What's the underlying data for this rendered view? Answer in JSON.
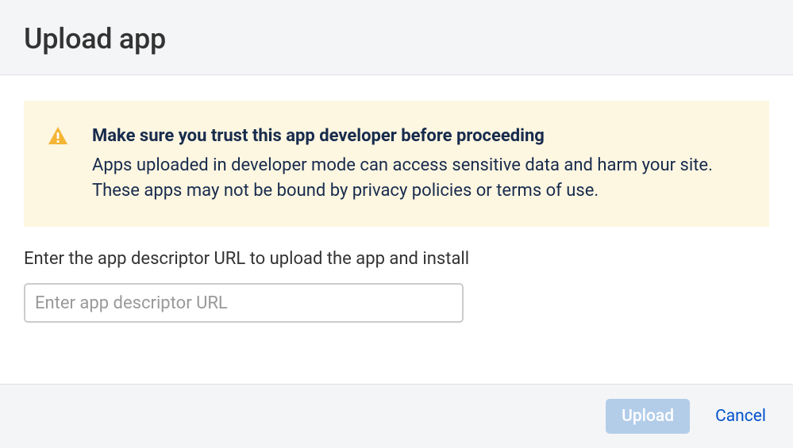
{
  "header": {
    "title": "Upload app"
  },
  "warning": {
    "icon": "warning-triangle",
    "title": "Make sure you trust this app developer before proceeding",
    "description": "Apps uploaded in developer mode can access sensitive data and harm your site. These apps may not be bound by privacy policies or terms of use."
  },
  "form": {
    "label": "Enter the app descriptor URL to upload the app and install",
    "url_placeholder": "Enter app descriptor URL",
    "url_value": ""
  },
  "actions": {
    "upload_label": "Upload",
    "cancel_label": "Cancel"
  },
  "colors": {
    "warning_bg": "#fdf6e1",
    "warning_icon": "#f4b434",
    "primary_button_bg": "#b3cde9",
    "link": "#0052cc"
  }
}
